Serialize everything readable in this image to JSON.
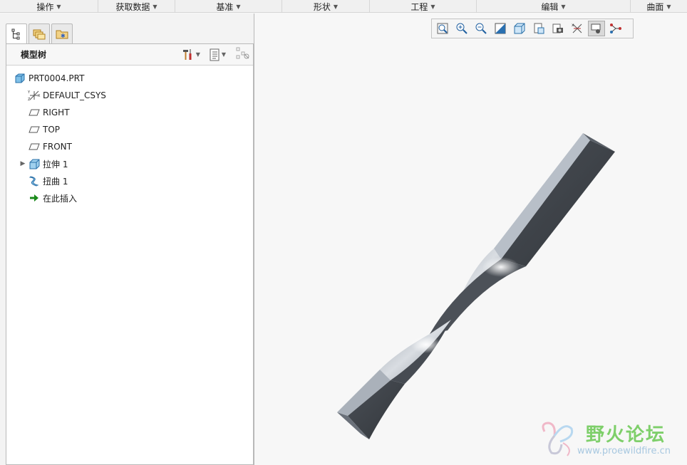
{
  "ribbon": {
    "groups": [
      {
        "label": "操作"
      },
      {
        "label": "获取数据"
      },
      {
        "label": "基准"
      },
      {
        "label": "形状"
      },
      {
        "label": "工程"
      },
      {
        "label": "编辑"
      },
      {
        "label": "曲面"
      }
    ]
  },
  "model_tree": {
    "title": "模型树",
    "items": [
      {
        "label": "PRT0004.PRT",
        "icon": "part-icon"
      },
      {
        "label": "DEFAULT_CSYS",
        "icon": "csys-icon"
      },
      {
        "label": "RIGHT",
        "icon": "datum-plane-icon"
      },
      {
        "label": "TOP",
        "icon": "datum-plane-icon"
      },
      {
        "label": "FRONT",
        "icon": "datum-plane-icon"
      },
      {
        "label": "拉伸 1",
        "icon": "extrude-icon"
      },
      {
        "label": "扭曲 1",
        "icon": "twist-icon"
      },
      {
        "label": "在此插入",
        "icon": "insert-here-arrow-icon"
      }
    ]
  },
  "watermark": {
    "title": "野火论坛",
    "url": "www.proewildfire.cn"
  },
  "colors": {
    "model_light": "#b7bec8",
    "model_dark": "#3f444a",
    "insert_arrow": "#1a8a1a",
    "watermark_green": "#7ecf6a"
  }
}
